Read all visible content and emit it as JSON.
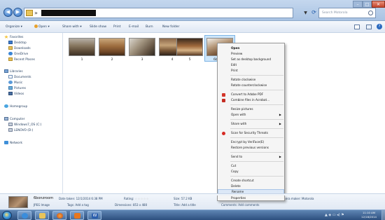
{
  "titlebar": {
    "address_path": "",
    "search_placeholder": "Search Motorola"
  },
  "toolbar": {
    "organize": "Organize ▾",
    "open": "Open ▾",
    "share_with": "Share with ▾",
    "slide_show": "Slide show",
    "print": "Print",
    "email": "E-mail",
    "burn": "Burn",
    "new_folder": "New folder"
  },
  "nav": {
    "favorites": "Favorites",
    "desktop": "Desktop",
    "downloads": "Downloads",
    "onedrive": "OneDrive",
    "recent_places": "Recent Places",
    "libraries": "Libraries",
    "documents": "Documents",
    "music": "Music",
    "pictures": "Pictures",
    "videos": "Videos",
    "homegroup": "Homegroup",
    "computer": "Computer",
    "drive_c": "Windows7_OS (C:)",
    "drive_d": "LENOVO (D:)",
    "network": "Network"
  },
  "files": [
    {
      "label": "1"
    },
    {
      "label": "2"
    },
    {
      "label": "3"
    },
    {
      "label": "4"
    },
    {
      "label": "5"
    },
    {
      "label": "6bonz..."
    }
  ],
  "context_menu": {
    "open": "Open",
    "preview": "Preview",
    "set_bg": "Set as desktop background",
    "edit": "Edit",
    "print": "Print",
    "rotate_cw": "Rotate clockwise",
    "rotate_ccw": "Rotate counterclockwise",
    "convert_pdf": "Convert to Adobe PDF",
    "combine_acrobat": "Combine files in Acrobat...",
    "resize": "Resize pictures",
    "open_with": "Open with",
    "share_with": "Share with",
    "scan": "Scan for Security Threats",
    "encrypt": "Encrypt by VeriFace(E)",
    "restore": "Restore previous versions",
    "send_to": "Send to",
    "cut": "Cut",
    "copy": "Copy",
    "create_shortcut": "Create shortcut",
    "delete": "Delete",
    "rename": "Rename",
    "properties": "Properties"
  },
  "details": {
    "filename": "6bonzroom",
    "date_label": "Date taken: 12/1/2014 6:38 PM",
    "type": "JPEG Image",
    "tags": "Tags: Add a tag",
    "rating_label": "Rating:",
    "dimensions": "Dimensions: 853 x 480",
    "size": "Size: 57.2 KB",
    "title": "Title: Add a title",
    "comments": "Comments: Add comments",
    "camera": "era maker: Motorola"
  },
  "taskbar": {
    "time": "11:10 AM",
    "date": "12/18/2014",
    "tray": "▲ ◈ ▭ ◂) ⚑"
  }
}
